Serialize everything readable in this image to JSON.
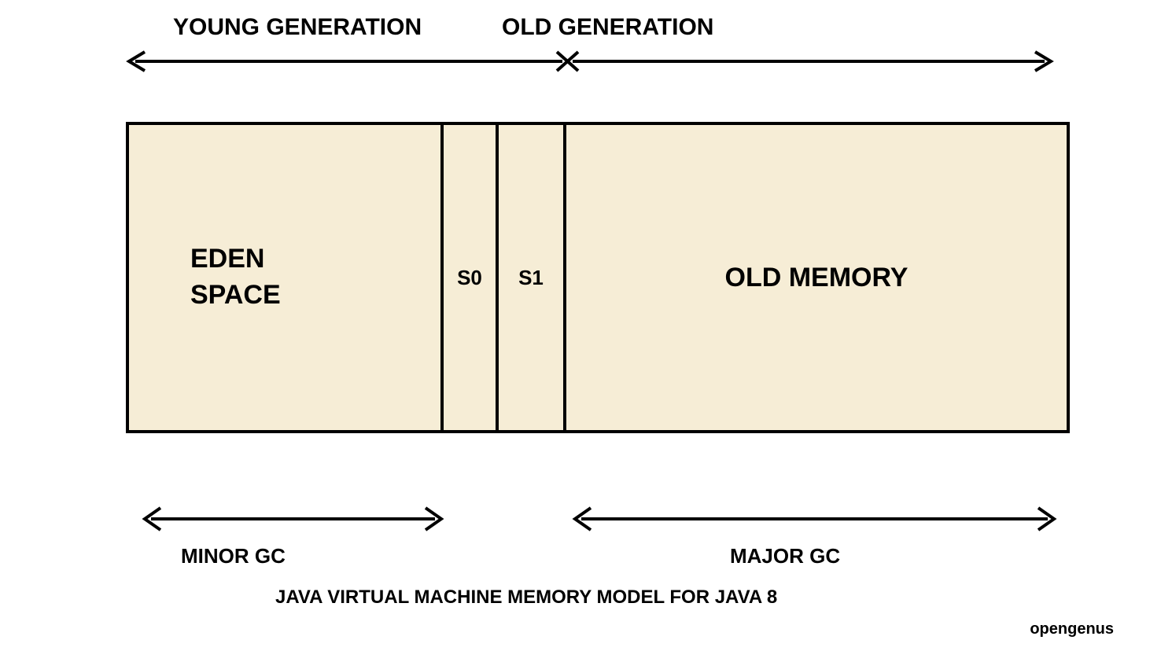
{
  "top": {
    "young_label": "YOUNG GENERATION",
    "old_label": "OLD GENERATION"
  },
  "boxes": {
    "eden": "EDEN\nSPACE",
    "s0": "S0",
    "s1": "S1",
    "old": "OLD MEMORY"
  },
  "bottom": {
    "minor_gc": "MINOR GC",
    "major_gc": "MAJOR GC"
  },
  "caption": "JAVA VIRTUAL MACHINE MEMORY MODEL FOR JAVA 8",
  "watermark": "opengenus"
}
